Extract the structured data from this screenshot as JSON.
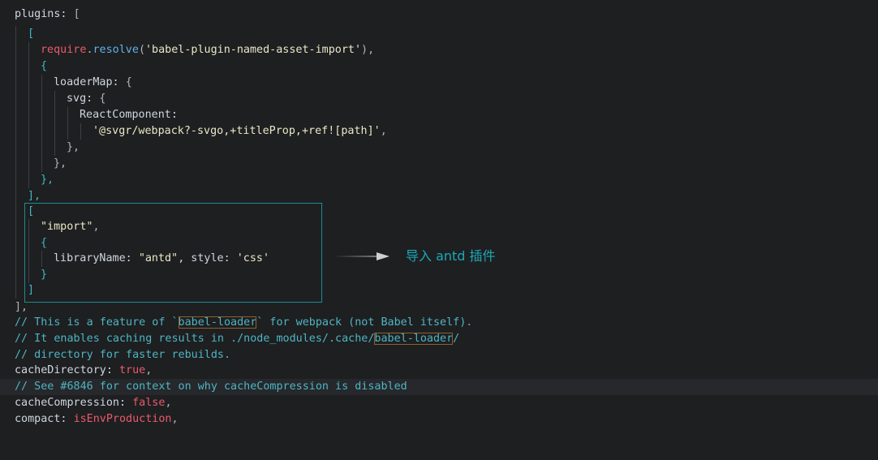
{
  "code": {
    "l1": {
      "a": "plugins: ",
      "b": "["
    },
    "l2": {
      "a": "["
    },
    "l3": {
      "kw": "require",
      "dot": ".",
      "fn": "resolve",
      "p1": "(",
      "s": "'babel-plugin-named-asset-import'",
      "p2": "),"
    },
    "l4": {
      "a": "{"
    },
    "l5": {
      "a": "loaderMap: ",
      "b": "{"
    },
    "l6": {
      "a": "svg: ",
      "b": "{"
    },
    "l7": {
      "a": "ReactComponent:"
    },
    "l8": {
      "s": "'@svgr/webpack?-svgo,+titleProp,+ref![path]'",
      "c": ","
    },
    "l9": {
      "a": "},"
    },
    "l10": {
      "a": "},"
    },
    "l11": {
      "a": "},"
    },
    "l12": {
      "a": "],"
    },
    "l13": {
      "a": "["
    },
    "l14": {
      "s": "\"import\"",
      "c": ","
    },
    "l15": {
      "a": "{"
    },
    "l16": {
      "a": "libraryName: ",
      "s1": "\"antd\"",
      "b": ", style: ",
      "s2": "'css'"
    },
    "l17": {
      "a": "}"
    },
    "l18": {
      "a": "]"
    },
    "l19": {
      "a": "],"
    },
    "l20": {
      "pre": "// This is a feature of `",
      "hl": "babel-loader",
      "post": "` for webpack (not Babel itself)."
    },
    "l21": {
      "pre": "// It enables caching results in ./node_modules/.cache/",
      "hl": "babel-loader",
      "post": "/"
    },
    "l22": {
      "a": "// directory for faster rebuilds."
    },
    "l23": {
      "a": "cacheDirectory: ",
      "v": "true",
      "c": ","
    },
    "l24": {
      "a": "// See #6846 for context on why cacheCompression is disabled"
    },
    "l25": {
      "a": "cacheCompression: ",
      "v": "false",
      "c": ","
    },
    "l26": {
      "a": "compact: ",
      "v": "isEnvProduction",
      "c": ","
    }
  },
  "annotation": {
    "text": "导入 antd 插件"
  },
  "colors": {
    "annotation": "#1aa9b7",
    "box": "#1c8c8e",
    "highlight": "#8a6230"
  },
  "icons": {
    "arrow": "arrow-right-icon"
  }
}
